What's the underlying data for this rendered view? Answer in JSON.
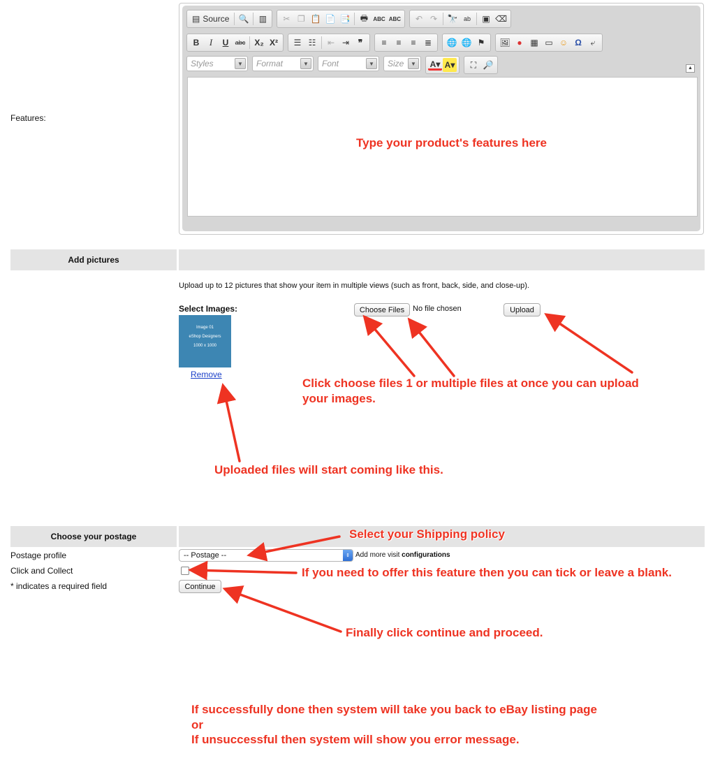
{
  "features": {
    "label": "Features:",
    "toolbar": {
      "source_label": "Source",
      "bold": "B",
      "italic": "I",
      "underline": "U",
      "strike": "abc",
      "subscript": "X₂",
      "superscript": "X²",
      "spell1": "ABC",
      "spell2": "ABC",
      "styles_placeholder": "Styles",
      "format_placeholder": "Format",
      "font_placeholder": "Font",
      "size_placeholder": "Size",
      "text_color": "A",
      "bg_color": "A"
    },
    "annotation": "Type your product's features here"
  },
  "pictures": {
    "section_title": "Add pictures",
    "instructions": "Upload up to 12 pictures that show your item in multiple views (such as front, back, side, and close-up).",
    "select_label": "Select Images:",
    "choose_files_label": "Choose Files",
    "no_file_text": "No file chosen",
    "upload_label": "Upload",
    "thumbnail": {
      "line1": "Image 01",
      "line2": "eShop Designers",
      "line3": "1000 x 1000"
    },
    "remove_label": "Remove",
    "annotation_choose_line1": "Click choose files 1 or multiple files at once you can upload",
    "annotation_choose_line2": "your images.",
    "annotation_uploaded": "Uploaded files will start coming like this."
  },
  "postage": {
    "section_title": "Choose your postage",
    "profile_label": "Postage profile",
    "profile_selected": "-- Postage --",
    "add_more_prefix": "Add more visit",
    "add_more_link": "configurations",
    "click_collect_label": "Click and Collect",
    "required_note": "* indicates a required field",
    "continue_label": "Continue",
    "annotation_shipping": "Select your Shipping policy",
    "annotation_tick": "If you need to offer this feature then you can tick or leave a blank.",
    "annotation_continue": "Finally click continue and proceed."
  },
  "footer_note": {
    "line1": "If successfully done then system will take you back to eBay listing page",
    "line2": "or",
    "line3": "If unsuccessful then system will show you error message."
  },
  "colors": {
    "annotation_red": "#ee3322",
    "section_bar": "#e4e4e4",
    "thumbnail_blue": "#3d86b3"
  }
}
